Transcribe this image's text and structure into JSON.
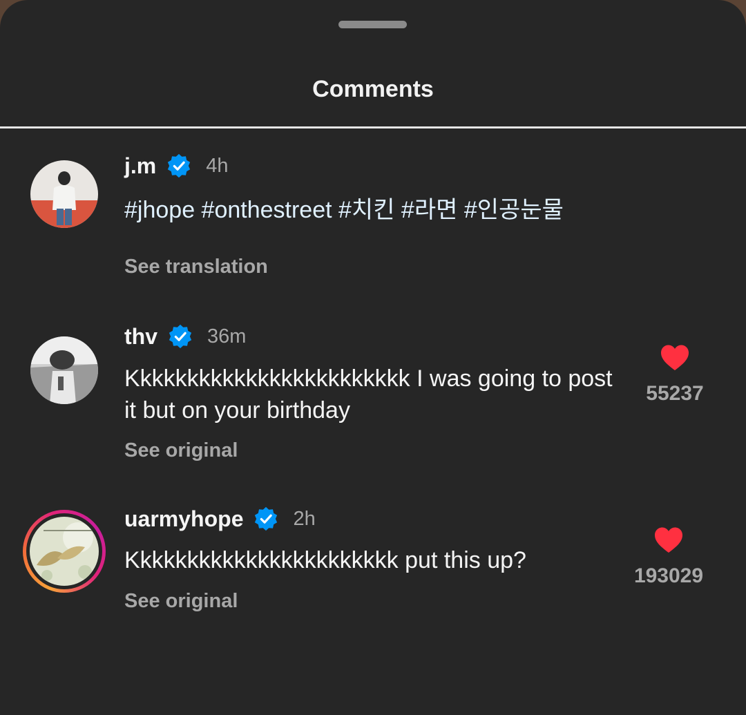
{
  "sheet": {
    "title": "Comments"
  },
  "comments": [
    {
      "username": "j.m",
      "verified": true,
      "time": "4h",
      "text": "#jhope #onthestreet #치킨 #라면 #인공눈물",
      "link": "See translation",
      "avatar_icon": "profile-photo"
    },
    {
      "username": "thv",
      "verified": true,
      "time": "36m",
      "text": "Kkkkkkkkkkkkkkkkkkkkkkkk I was going to post it but on your birthday",
      "link": "See original",
      "likes": "55237",
      "avatar_icon": "profile-photo"
    },
    {
      "username": "uarmyhope",
      "verified": true,
      "time": "2h",
      "text": "Kkkkkkkkkkkkkkkkkkkkkkk put this up?",
      "link": "See original",
      "likes": "193029",
      "avatar_icon": "profile-photo-with-story-ring"
    }
  ],
  "colors": {
    "sheet_background": "#262626",
    "verified_badge": "#0095f6",
    "heart": "#ff3040",
    "muted_text": "#a8a8a8"
  }
}
